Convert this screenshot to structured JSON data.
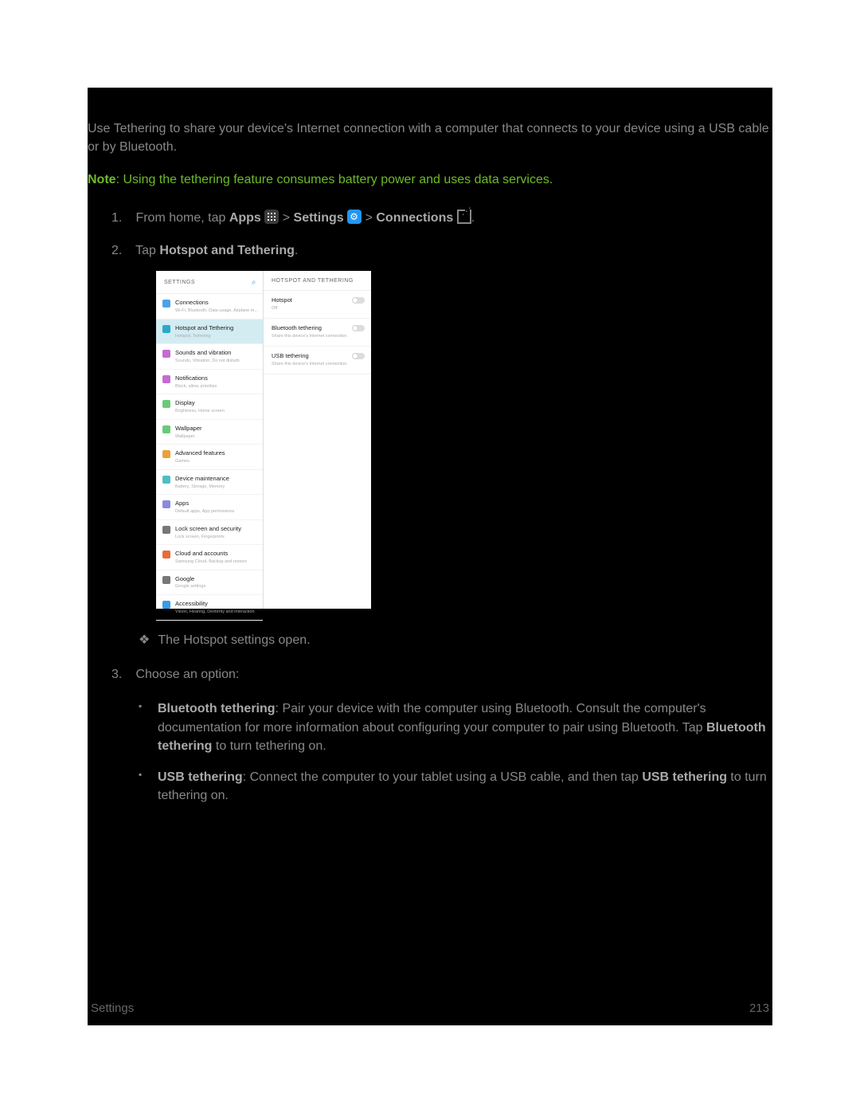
{
  "intro": "Use Tethering to share your device's Internet connection with a computer that connects to your device using a USB cable or by Bluetooth.",
  "note_label": "Note",
  "note_text": ": Using the tethering feature consumes battery power and uses data services.",
  "step1": {
    "pre": "From home, tap ",
    "apps": "Apps",
    "gt1": " > ",
    "settings": "Settings",
    "gt2": " > ",
    "connections": "Connections",
    "post": "."
  },
  "step2": {
    "pre": "Tap ",
    "b": "Hotspot and Tethering",
    "post": "."
  },
  "result": "The Hotspot settings open.",
  "step3": "Choose an option:",
  "opt1_b1": "Bluetooth tethering",
  "opt1_t1": ": Pair your device with the computer using Bluetooth. Consult the computer's documentation for more information about configuring your computer to pair using Bluetooth. Tap ",
  "opt1_b2": "Bluetooth tethering",
  "opt1_t2": " to turn tethering on.",
  "opt2_b1": "USB tethering",
  "opt2_t1": ": Connect the computer to your tablet using a USB cable, and then tap ",
  "opt2_b2": "USB tethering",
  "opt2_t2": " to turn tethering on.",
  "footer_left": "Settings",
  "footer_right": "213",
  "shot": {
    "hdr_left": "SETTINGS",
    "hdr_right_icon": "⌕",
    "hdr_right": "HOTSPOT AND TETHERING",
    "left_rows": [
      {
        "t": "Connections",
        "s": "Wi-Fi, Bluetooth, Data usage, Airplane m...",
        "c": "#4aa3e8"
      },
      {
        "t": "Hotspot and Tethering",
        "s": "Hotspot, Tethering",
        "c": "#2aa9c9",
        "sel": true
      },
      {
        "t": "Sounds and vibration",
        "s": "Sounds, Vibration, Do not disturb",
        "c": "#c66bd1"
      },
      {
        "t": "Notifications",
        "s": "Block, allow, prioritize",
        "c": "#c66bd1"
      },
      {
        "t": "Display",
        "s": "Brightness, Home screen",
        "c": "#6bca7a"
      },
      {
        "t": "Wallpaper",
        "s": "Wallpaper",
        "c": "#6bca7a"
      },
      {
        "t": "Advanced features",
        "s": "Games",
        "c": "#e8a23a"
      },
      {
        "t": "Device maintenance",
        "s": "Battery, Storage, Memory",
        "c": "#4bc0c0"
      },
      {
        "t": "Apps",
        "s": "Default apps, App permissions",
        "c": "#8a8ae0"
      },
      {
        "t": "Lock screen and security",
        "s": "Lock screen, Fingerprints",
        "c": "#777"
      },
      {
        "t": "Cloud and accounts",
        "s": "Samsung Cloud, Backup and restore",
        "c": "#e86b3a"
      },
      {
        "t": "Google",
        "s": "Google settings",
        "c": "#777"
      },
      {
        "t": "Accessibility",
        "s": "Vision, Hearing, Dexterity and interaction",
        "c": "#3a9be8"
      }
    ],
    "right_rows": [
      {
        "t": "Hotspot",
        "s": "Off"
      },
      {
        "t": "Bluetooth tethering",
        "s": "Share this device's Internet connection."
      },
      {
        "t": "USB tethering",
        "s": "Share this device's Internet connection."
      }
    ]
  }
}
